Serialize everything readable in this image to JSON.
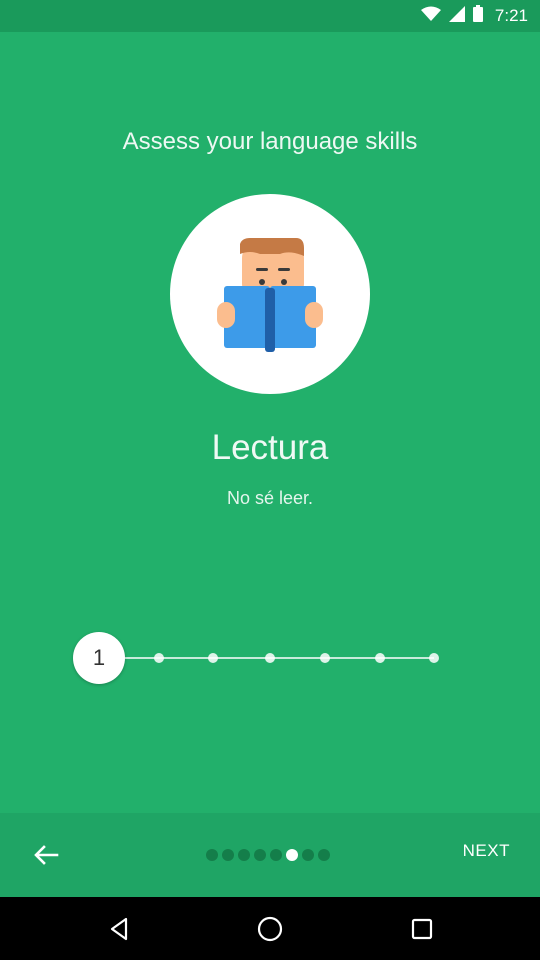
{
  "status_bar": {
    "time": "7:21",
    "icons": [
      "wifi-icon",
      "signal-icon",
      "battery-icon"
    ]
  },
  "screen": {
    "title": "Assess your language skills",
    "skill_title": "Lectura",
    "skill_description": "No sé leer.",
    "illustration": "reading-person-icon"
  },
  "level_selector": {
    "current_level": "1",
    "total_levels": 7
  },
  "bottom_bar": {
    "back_icon": "arrow-left-icon",
    "page_count": 8,
    "active_page": 6,
    "next_label": "NEXT"
  },
  "navigation_bar": {
    "icons": [
      "back-triangle-icon",
      "home-circle-icon",
      "recents-square-icon"
    ]
  },
  "colors": {
    "background": "#22b06b",
    "status_bar": "#1a9a5b",
    "bottom_bar": "#1fa565",
    "book": "#3d9be9",
    "hair": "#c57a45",
    "skin": "#fbbd8e"
  }
}
